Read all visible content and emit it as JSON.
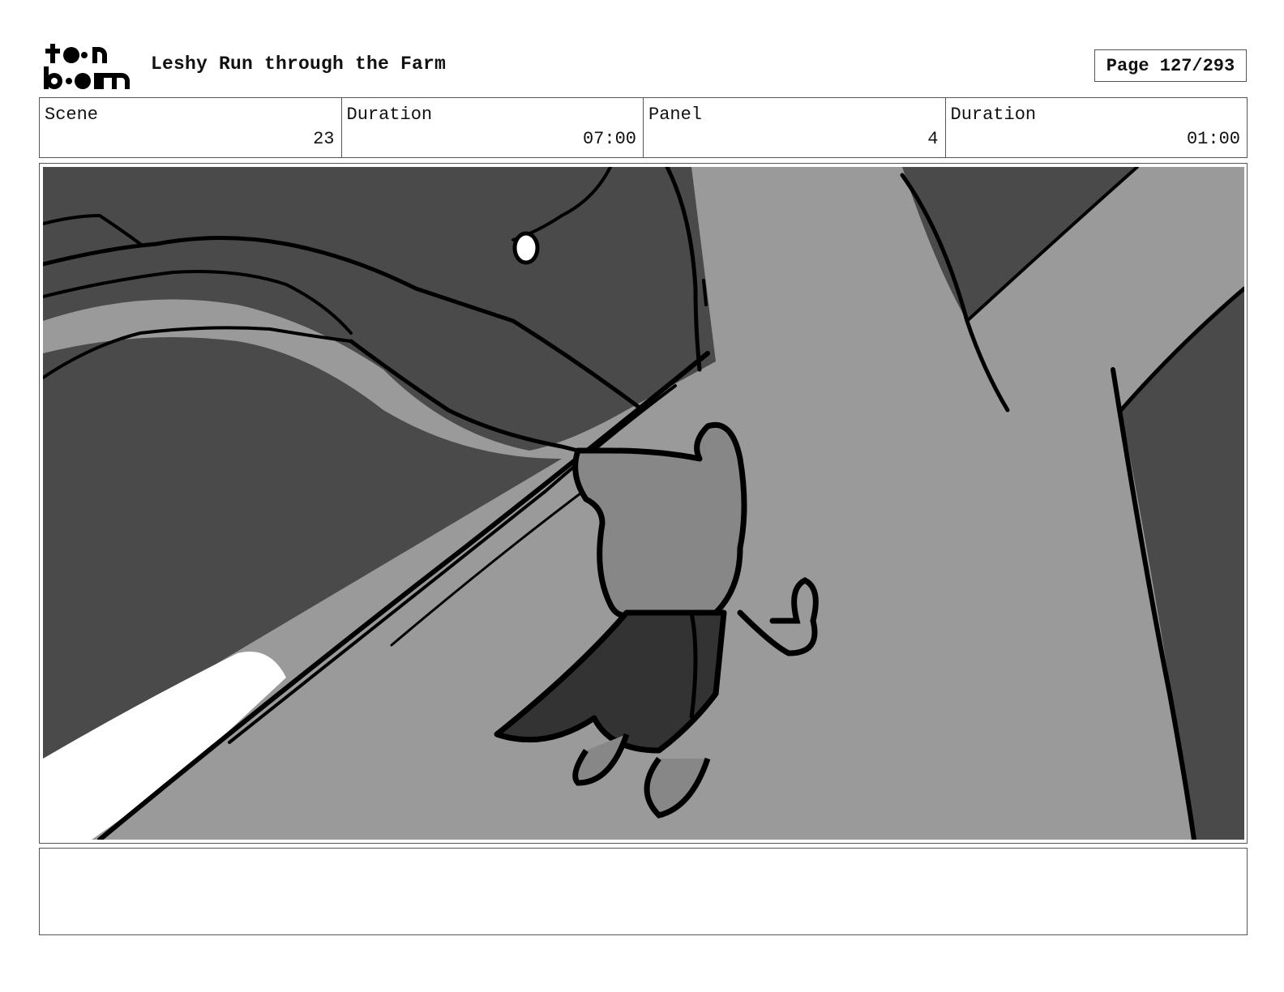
{
  "header": {
    "logo_icon": "toonboom-logo",
    "title": "Leshy Run through the Farm",
    "page_label": "Page 127/293"
  },
  "info": {
    "scene_label": "Scene",
    "scene_value": "23",
    "duration_label": "Duration",
    "duration_value": "07:00",
    "panel_label": "Panel",
    "panel_value": "4",
    "panel_duration_label": "Duration",
    "panel_duration_value": "01:00"
  },
  "colors": {
    "dark_gray": "#4a4a4a",
    "mid_gray": "#9a9a9a",
    "figure_gray": "#878787",
    "cloth_gray": "#333333",
    "ink": "#000000"
  }
}
